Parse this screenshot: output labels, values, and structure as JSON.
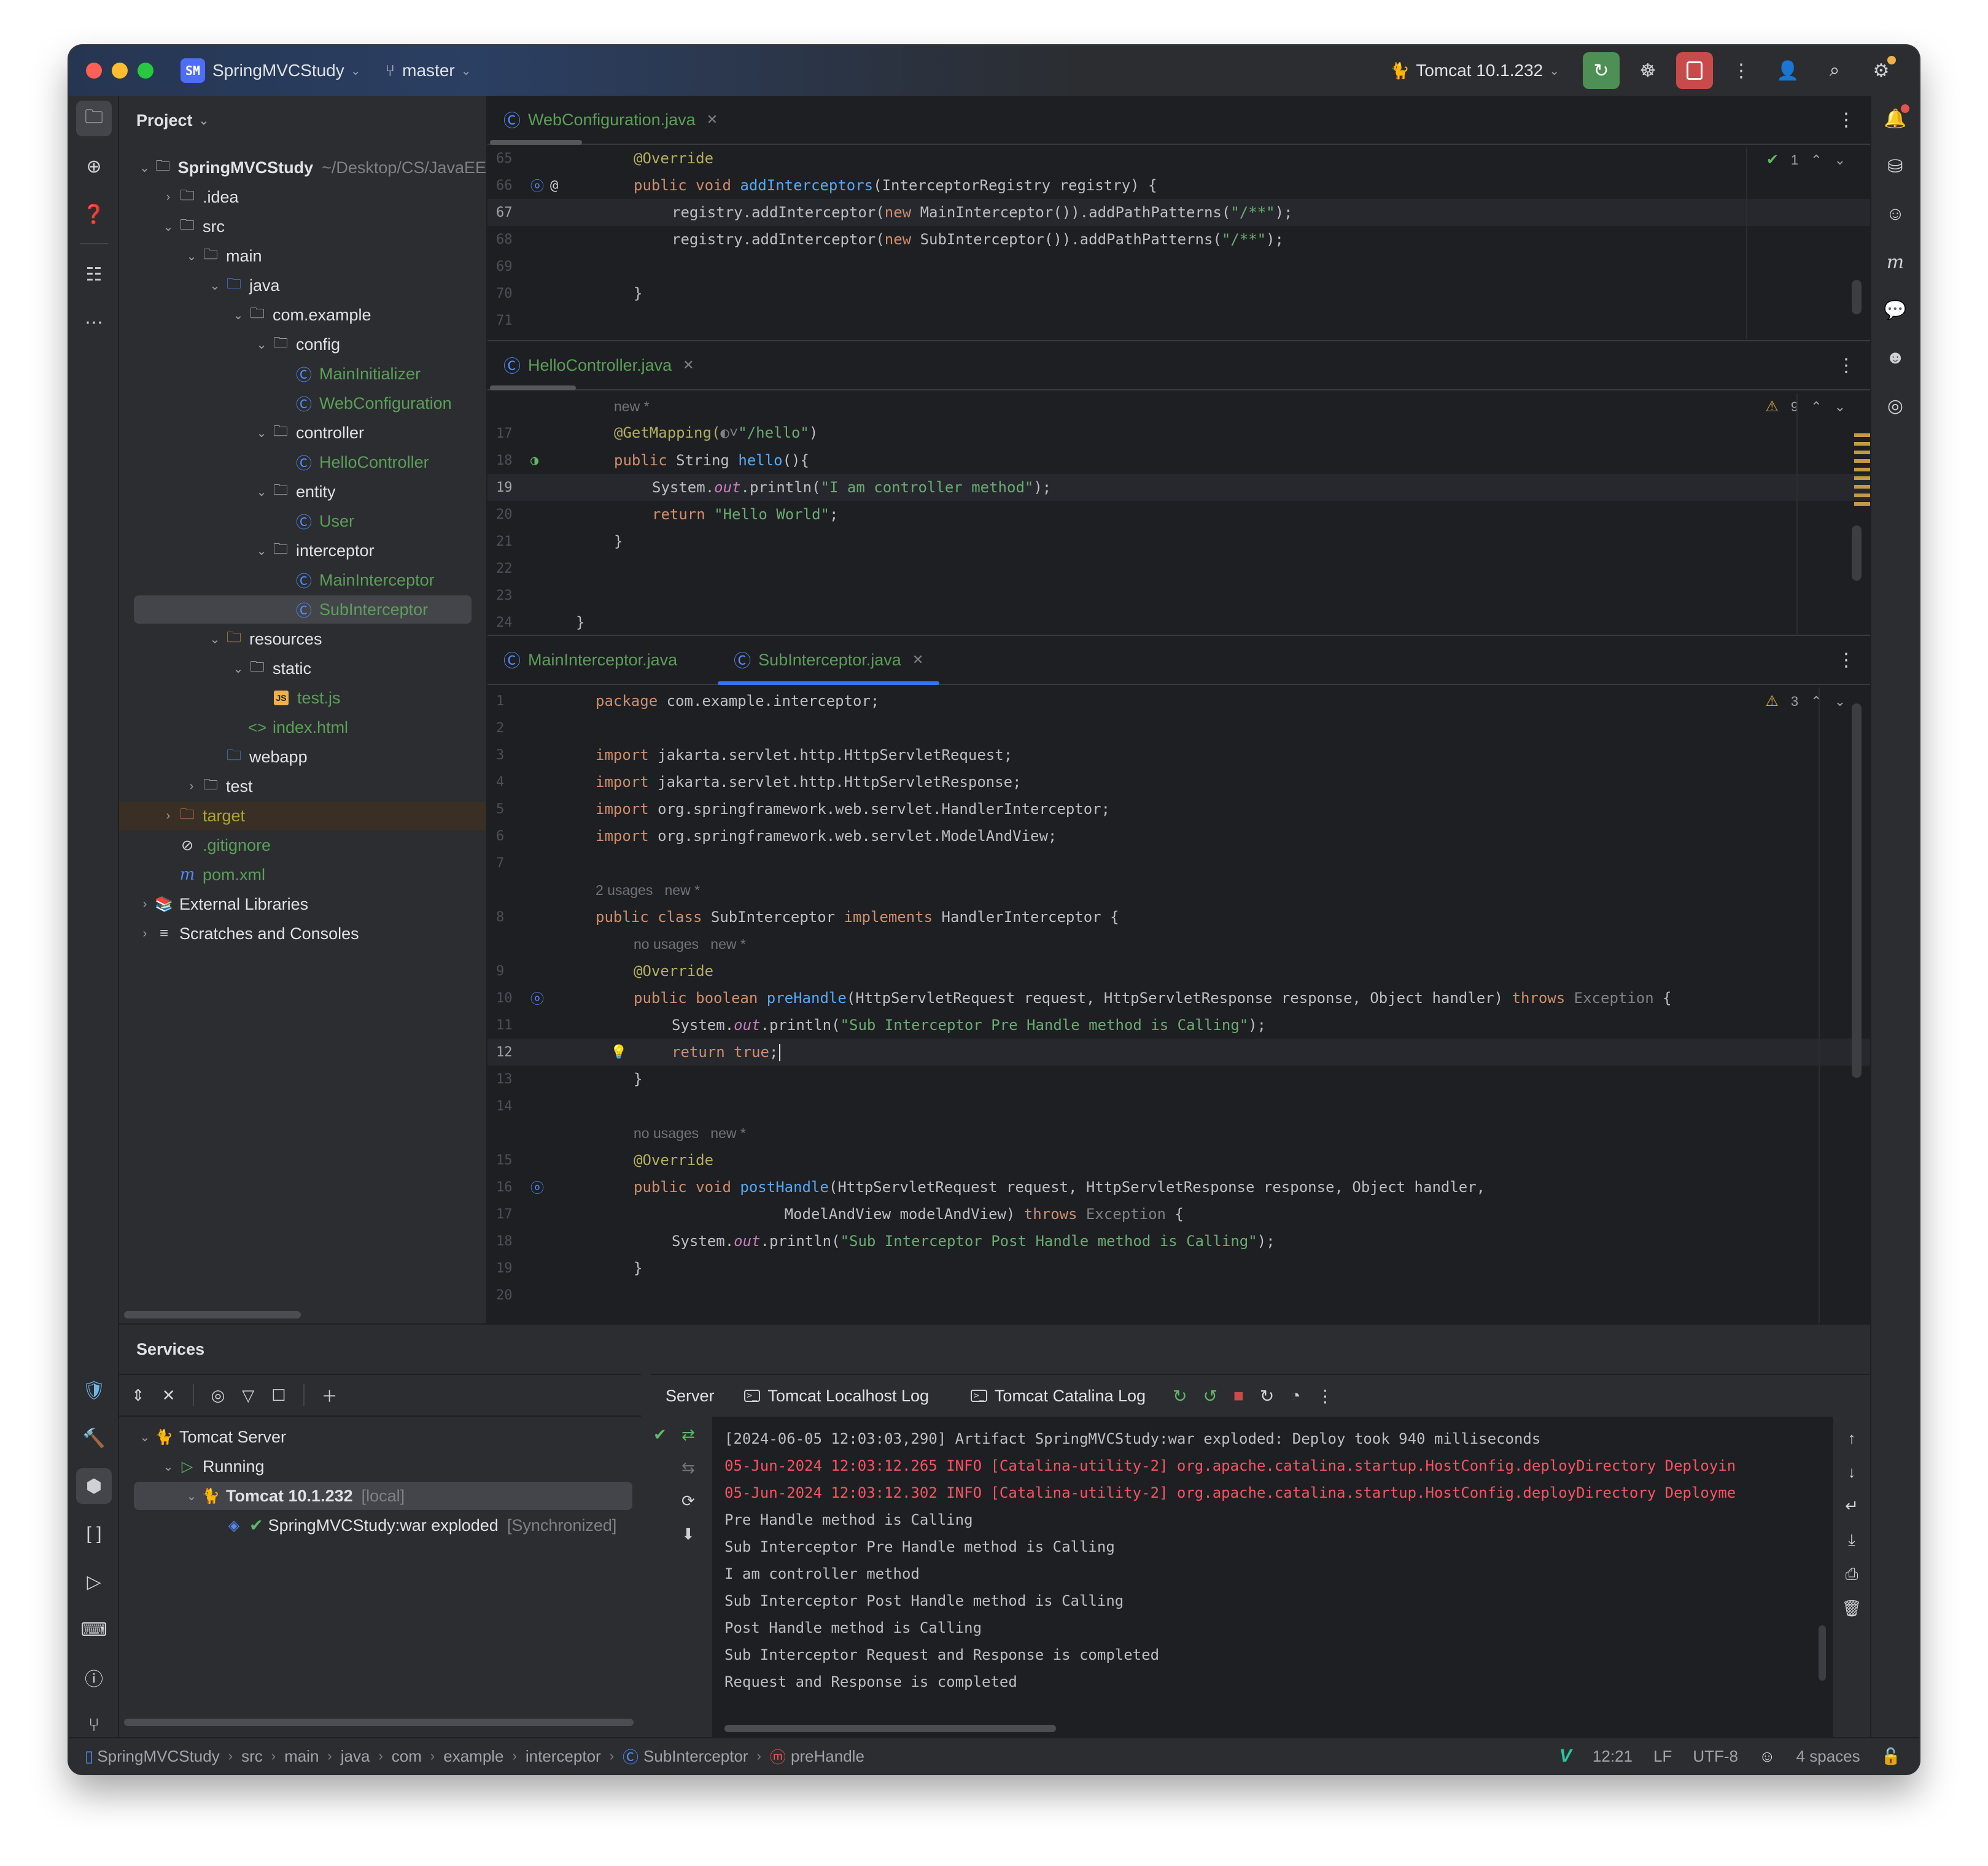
{
  "titlebar": {
    "project_badge": "SM",
    "project_name": "SpringMVCStudy",
    "branch": "master",
    "run_config": "Tomcat 10.1.232",
    "icons": [
      "rerun-icon",
      "debug-icon",
      "stop-icon",
      "more-icon",
      "add-user-icon",
      "search-icon",
      "settings-icon"
    ]
  },
  "project_panel": {
    "title": "Project",
    "root_name": "SpringMVCStudy",
    "root_path": "~/Desktop/CS/JavaEE",
    "items": [
      {
        "label": ".idea",
        "type": "folder"
      },
      {
        "label": "src",
        "type": "folder"
      },
      {
        "label": "main",
        "type": "folder"
      },
      {
        "label": "java",
        "type": "source-folder"
      },
      {
        "label": "com.example",
        "type": "package"
      },
      {
        "label": "config",
        "type": "package"
      },
      {
        "label": "MainInitializer",
        "type": "class"
      },
      {
        "label": "WebConfiguration",
        "type": "class"
      },
      {
        "label": "controller",
        "type": "package"
      },
      {
        "label": "HelloController",
        "type": "class"
      },
      {
        "label": "entity",
        "type": "package"
      },
      {
        "label": "User",
        "type": "class"
      },
      {
        "label": "interceptor",
        "type": "package"
      },
      {
        "label": "MainInterceptor",
        "type": "class"
      },
      {
        "label": "SubInterceptor",
        "type": "class",
        "selected": true
      },
      {
        "label": "resources",
        "type": "resources-folder"
      },
      {
        "label": "static",
        "type": "folder"
      },
      {
        "label": "test.js",
        "type": "js"
      },
      {
        "label": "index.html",
        "type": "html"
      },
      {
        "label": "webapp",
        "type": "web-folder"
      },
      {
        "label": "test",
        "type": "folder"
      },
      {
        "label": "target",
        "type": "excluded-folder"
      },
      {
        "label": ".gitignore",
        "type": "ignore"
      },
      {
        "label": "pom.xml",
        "type": "maven"
      },
      {
        "label": "External Libraries",
        "type": "library"
      },
      {
        "label": "Scratches and Consoles",
        "type": "scratches"
      }
    ]
  },
  "editor1": {
    "tab": "WebConfiguration.java",
    "inspection_count": "1",
    "lines": [
      {
        "n": "65",
        "code": [
          [
            "an",
            "@Override"
          ]
        ],
        "indent": 1
      },
      {
        "n": "66",
        "code": [
          [
            "kw",
            "public void "
          ],
          [
            "fn",
            "addInterceptors"
          ],
          [
            "pl",
            "(InterceptorRegistry registry) {"
          ]
        ],
        "indent": 1
      },
      {
        "n": "67",
        "code": [
          [
            "pl",
            "registry.addInterceptor("
          ],
          [
            "kw",
            "new "
          ],
          [
            "pl",
            "MainInterceptor()).addPathPatterns("
          ],
          [
            "st",
            "\"/**\""
          ],
          [
            "pl",
            ");"
          ]
        ],
        "indent": 2,
        "current": true
      },
      {
        "n": "68",
        "code": [
          [
            "pl",
            "registry.addInterceptor("
          ],
          [
            "kw",
            "new "
          ],
          [
            "pl",
            "SubInterceptor()).addPathPatterns("
          ],
          [
            "st",
            "\"/**\""
          ],
          [
            "pl",
            ");"
          ]
        ],
        "indent": 2
      },
      {
        "n": "69",
        "code": [],
        "indent": 2
      },
      {
        "n": "70",
        "code": [
          [
            "pl",
            "}"
          ]
        ],
        "indent": 1
      },
      {
        "n": "71",
        "code": [],
        "indent": 0
      }
    ]
  },
  "editor2": {
    "tab": "HelloController.java",
    "warning_count": "9",
    "hint": "new *",
    "lines": [
      {
        "n": "17",
        "code": [
          [
            "an",
            "@GetMapping("
          ],
          [
            "gr",
            "◐˅"
          ],
          [
            "st",
            "\"/hello\""
          ],
          [
            "pl",
            ")"
          ]
        ],
        "indent": 1
      },
      {
        "n": "18",
        "code": [
          [
            "kw",
            "public "
          ],
          [
            "pl",
            "String "
          ],
          [
            "fn",
            "hello"
          ],
          [
            "pl",
            "(){"
          ]
        ],
        "indent": 1
      },
      {
        "n": "19",
        "code": [
          [
            "pl",
            "System."
          ],
          [
            "fld",
            "out"
          ],
          [
            "pl",
            ".println("
          ],
          [
            "st",
            "\"I am controller method\""
          ],
          [
            "pl",
            ");"
          ]
        ],
        "indent": 2,
        "current": true
      },
      {
        "n": "20",
        "code": [
          [
            "kw",
            "return "
          ],
          [
            "st",
            "\"Hello World\""
          ],
          [
            "pl",
            ";"
          ]
        ],
        "indent": 2
      },
      {
        "n": "21",
        "code": [
          [
            "pl",
            "}"
          ]
        ],
        "indent": 1
      },
      {
        "n": "22",
        "code": [],
        "indent": 0
      },
      {
        "n": "23",
        "code": [],
        "indent": 0
      },
      {
        "n": "24",
        "code": [
          [
            "pl",
            "}"
          ]
        ],
        "indent": 0
      }
    ]
  },
  "editor3": {
    "tabs": [
      {
        "label": "MainInterceptor.java",
        "active": false
      },
      {
        "label": "SubInterceptor.java",
        "active": true
      }
    ],
    "warning_count": "3",
    "lines": [
      {
        "n": "1",
        "code": [
          [
            "kw",
            "package "
          ],
          [
            "pl",
            "com.example.interceptor;"
          ]
        ],
        "indent": 0
      },
      {
        "n": "2",
        "code": [],
        "indent": 0
      },
      {
        "n": "3",
        "code": [
          [
            "kw",
            "import "
          ],
          [
            "pl",
            "jakarta.servlet.http.HttpServletRequest;"
          ]
        ],
        "indent": 0
      },
      {
        "n": "4",
        "code": [
          [
            "kw",
            "import "
          ],
          [
            "pl",
            "jakarta.servlet.http.HttpServletResponse;"
          ]
        ],
        "indent": 0
      },
      {
        "n": "5",
        "code": [
          [
            "kw",
            "import "
          ],
          [
            "pl",
            "org.springframework.web.servlet.HandlerInterceptor;"
          ]
        ],
        "indent": 0
      },
      {
        "n": "6",
        "code": [
          [
            "kw",
            "import "
          ],
          [
            "pl",
            "org.springframework.web.servlet.ModelAndView;"
          ]
        ],
        "indent": 0
      },
      {
        "n": "7",
        "code": [],
        "indent": 0
      },
      {
        "n": "",
        "hint": "2 usages   new *",
        "indent": 0
      },
      {
        "n": "8",
        "code": [
          [
            "kw",
            "public class "
          ],
          [
            "pl",
            "SubInterceptor "
          ],
          [
            "kw",
            "implements "
          ],
          [
            "pl",
            "HandlerInterceptor {"
          ]
        ],
        "indent": 0
      },
      {
        "n": "",
        "hint": "no usages   new *",
        "indent": 1
      },
      {
        "n": "9",
        "code": [
          [
            "an",
            "@Override"
          ]
        ],
        "indent": 1
      },
      {
        "n": "10",
        "code": [
          [
            "kw",
            "public boolean "
          ],
          [
            "fn",
            "preHandle"
          ],
          [
            "pl",
            "(HttpServletRequest request, HttpServletResponse response, Object handler) "
          ],
          [
            "kw",
            "throws "
          ],
          [
            "gr",
            "Exception "
          ],
          [
            "pl",
            "{"
          ]
        ],
        "indent": 1
      },
      {
        "n": "11",
        "code": [
          [
            "pl",
            "System."
          ],
          [
            "fld",
            "out"
          ],
          [
            "pl",
            ".println("
          ],
          [
            "st",
            "\"Sub Interceptor Pre Handle method is Calling\""
          ],
          [
            "pl",
            ");"
          ]
        ],
        "indent": 2
      },
      {
        "n": "12",
        "code": [
          [
            "kw",
            "return true"
          ],
          [
            "pl",
            ";"
          ]
        ],
        "indent": 2,
        "current": true
      },
      {
        "n": "13",
        "code": [
          [
            "pl",
            "}"
          ]
        ],
        "indent": 1
      },
      {
        "n": "14",
        "code": [],
        "indent": 0
      },
      {
        "n": "",
        "hint": "no usages   new *",
        "indent": 1
      },
      {
        "n": "15",
        "code": [
          [
            "an",
            "@Override"
          ]
        ],
        "indent": 1
      },
      {
        "n": "16",
        "code": [
          [
            "kw",
            "public void "
          ],
          [
            "fn",
            "postHandle"
          ],
          [
            "pl",
            "(HttpServletRequest request, HttpServletResponse response, Object handler,"
          ]
        ],
        "indent": 1
      },
      {
        "n": "17",
        "code": [
          [
            "pl",
            "                 ModelAndView modelAndView) "
          ],
          [
            "kw",
            "throws "
          ],
          [
            "gr",
            "Exception "
          ],
          [
            "pl",
            "{"
          ]
        ],
        "indent": 1
      },
      {
        "n": "18",
        "code": [
          [
            "pl",
            "System."
          ],
          [
            "fld",
            "out"
          ],
          [
            "pl",
            ".println("
          ],
          [
            "st",
            "\"Sub Interceptor Post Handle method is Calling\""
          ],
          [
            "pl",
            ");"
          ]
        ],
        "indent": 2
      },
      {
        "n": "19",
        "code": [
          [
            "pl",
            "}"
          ]
        ],
        "indent": 1
      },
      {
        "n": "20",
        "code": [],
        "indent": 0
      }
    ]
  },
  "services": {
    "title": "Services",
    "tree": [
      {
        "label": "Tomcat Server",
        "suffix": ""
      },
      {
        "label": "Running",
        "suffix": ""
      },
      {
        "label": "Tomcat 10.1.232",
        "suffix": "[local]"
      },
      {
        "label": "SpringMVCStudy:war exploded",
        "suffix": "[Synchronized]"
      }
    ],
    "console_tabs": [
      "Server",
      "Tomcat Localhost Log",
      "Tomcat Catalina Log"
    ],
    "console_lines": [
      {
        "text": "[2024-06-05 12:03:03,290] Artifact SpringMVCStudy:war exploded: Deploy took 940 milliseconds",
        "kind": "out"
      },
      {
        "text": "05-Jun-2024 12:03:12.265 INFO [Catalina-utility-2] org.apache.catalina.startup.HostConfig.deployDirectory Deployin",
        "kind": "err"
      },
      {
        "text": "05-Jun-2024 12:03:12.302 INFO [Catalina-utility-2] org.apache.catalina.startup.HostConfig.deployDirectory Deployme",
        "kind": "err"
      },
      {
        "text": "Pre Handle method is Calling",
        "kind": "out"
      },
      {
        "text": "Sub Interceptor Pre Handle method is Calling",
        "kind": "out"
      },
      {
        "text": "I am controller method",
        "kind": "out"
      },
      {
        "text": "Sub Interceptor Post Handle method is Calling",
        "kind": "out"
      },
      {
        "text": "Post Handle method is Calling",
        "kind": "out"
      },
      {
        "text": "Sub Interceptor Request and Response is completed",
        "kind": "out"
      },
      {
        "text": "Request and Response is completed",
        "kind": "out"
      }
    ]
  },
  "statusbar": {
    "breadcrumbs": [
      "SpringMVCStudy",
      "src",
      "main",
      "java",
      "com",
      "example",
      "interceptor",
      "SubInterceptor",
      "preHandle"
    ],
    "cursor": "12:21",
    "line_separator": "LF",
    "encoding": "UTF-8",
    "indent": "4 spaces"
  },
  "colors": {
    "accent": "#3574f0",
    "keyword": "#cf8e6d",
    "string": "#6aab73",
    "function": "#56a8f5",
    "annotation": "#b3ae60",
    "error_log": "#f75464"
  }
}
